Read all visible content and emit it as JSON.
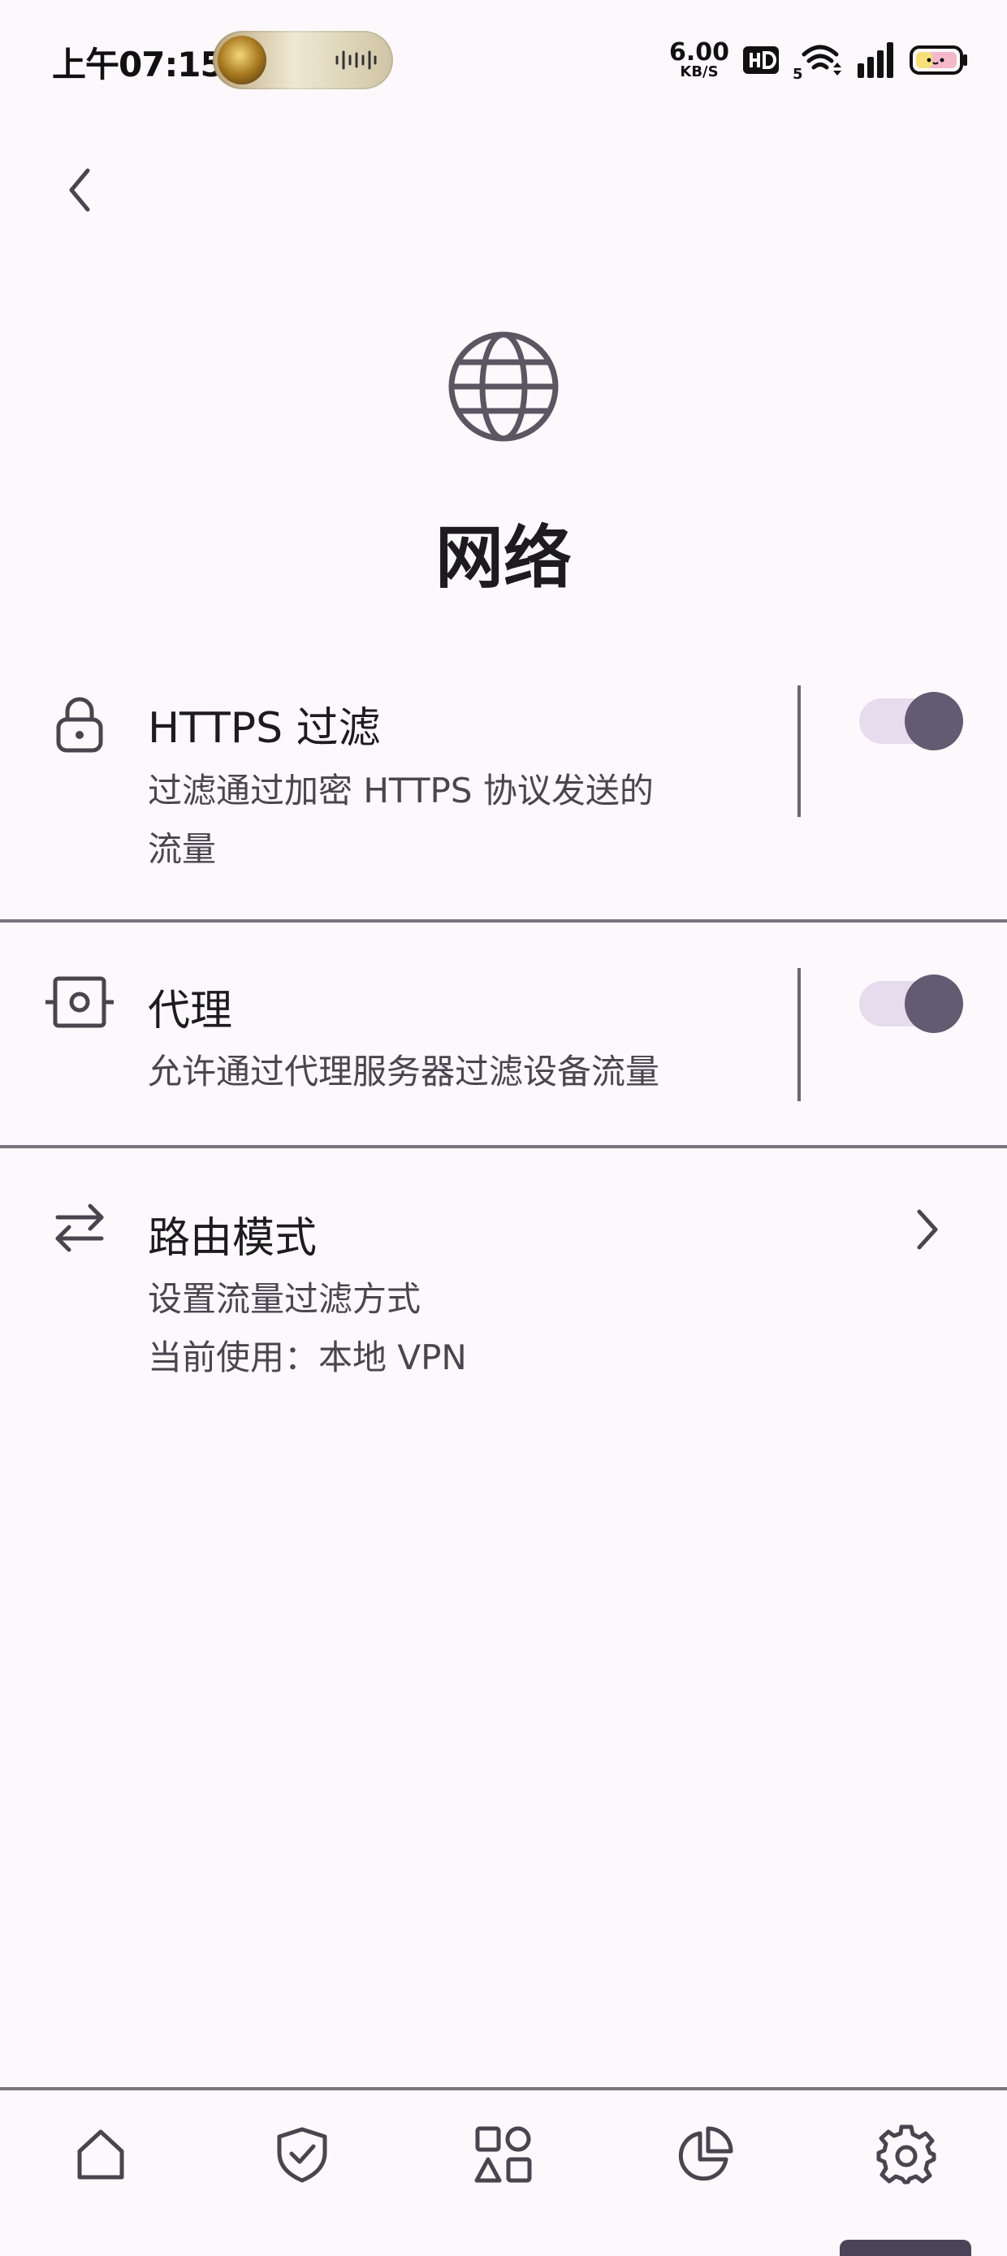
{
  "status_bar": {
    "time": "上午07:15",
    "net_speed_value": "6.00",
    "net_speed_unit": "KB/S",
    "icons": [
      "music-wave-icon",
      "hd-icon",
      "wifi-5g-icon",
      "signal-icon",
      "battery-icon"
    ]
  },
  "header": {
    "back_icon": "chevron-left-icon",
    "icon": "globe-icon",
    "title": "网络"
  },
  "settings": [
    {
      "id": "https-filtering",
      "icon": "lock-icon",
      "title": "HTTPS 过滤",
      "subtitle_lines": [
        "过滤通过加密 HTTPS 协议发送的",
        "流量"
      ],
      "toggle_on": true
    },
    {
      "id": "proxy",
      "icon": "proxy-icon",
      "title": "代理",
      "subtitle_lines": [
        "允许通过代理服务器过滤设备流量"
      ],
      "toggle_on": true
    },
    {
      "id": "routing-mode",
      "icon": "swap-arrows-icon",
      "title": "路由模式",
      "subtitle_lines": [
        "设置流量过滤方式",
        "当前使用：本地 VPN"
      ],
      "trailing_icon": "chevron-right-icon"
    }
  ],
  "bottom_nav": {
    "items": [
      {
        "id": "home",
        "icon": "home-icon"
      },
      {
        "id": "protection",
        "icon": "shield-check-icon"
      },
      {
        "id": "apps",
        "icon": "shapes-icon"
      },
      {
        "id": "statistics",
        "icon": "pie-chart-icon"
      },
      {
        "id": "settings",
        "icon": "gear-icon",
        "active": true
      }
    ]
  },
  "colors": {
    "background": "#fdf8fc",
    "primary_text": "#1d1b1f",
    "secondary_text": "#4a454e",
    "icon": "#49454f",
    "switch_track": "#e7dcee",
    "switch_thumb": "#625b71",
    "divider": "#79747e"
  }
}
